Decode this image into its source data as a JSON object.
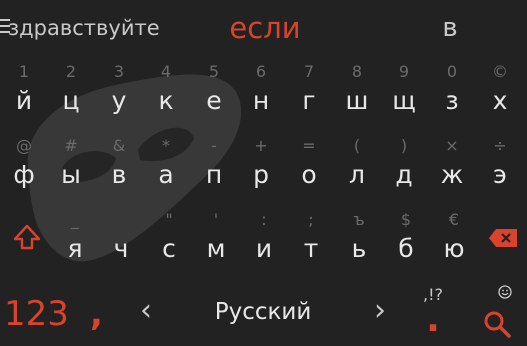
{
  "suggestions": {
    "left": "здравствуйте",
    "center": "если",
    "right": "в"
  },
  "row1": {
    "hints": [
      "1",
      "2",
      "3",
      "4",
      "5",
      "6",
      "7",
      "8",
      "9",
      "0",
      "©"
    ],
    "keys": [
      "й",
      "ц",
      "у",
      "к",
      "е",
      "н",
      "г",
      "ш",
      "щ",
      "з",
      "х"
    ]
  },
  "row2": {
    "hints": [
      "@",
      "#",
      "&",
      "*",
      "-",
      "+",
      "=",
      "(",
      ")",
      "×",
      "÷"
    ],
    "keys": [
      "ф",
      "ы",
      "в",
      "а",
      "п",
      "р",
      "о",
      "л",
      "д",
      "ж",
      "э"
    ]
  },
  "row3": {
    "hints": [
      "_",
      "\"",
      "'",
      ":",
      ";",
      "ъ",
      "$",
      "€"
    ],
    "keys": [
      "я",
      "ч",
      "с",
      "м",
      "и",
      "т",
      "ь",
      "б",
      "ю"
    ]
  },
  "bottom": {
    "numbers_label": "123",
    "comma": ",",
    "arrow_left": "‹",
    "language": "Русский",
    "arrow_right": "›",
    "punct_hint": ",!?",
    "period": "."
  },
  "colors": {
    "background": "#222222",
    "accent": "#d9432c",
    "text": "#e8e8e8",
    "hint": "#6b6b6b"
  },
  "icons": {
    "menu": "menu-icon",
    "shift": "shift-arrow-icon",
    "backspace": "backspace-icon",
    "emoji": "smiley-icon",
    "search": "search-icon",
    "incognito": "incognito-mask-icon"
  }
}
